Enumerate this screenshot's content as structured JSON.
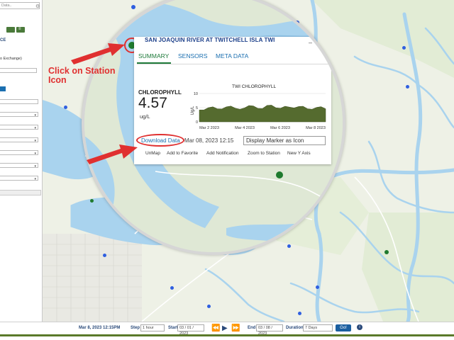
{
  "sidebar": {
    "search_placeholder": "Data..",
    "item_exchange": "o Exchange)",
    "section_label": "CE"
  },
  "popup": {
    "station_title": "SAN JOAQUIN RIVER AT TWITCHELL ISLA TWI",
    "minimize_icon": "minus",
    "close_icon": "close",
    "tabs": [
      "SUMMARY",
      "SENSORS",
      "META DATA"
    ],
    "measurement_label": "CHLOROPHYLL",
    "measurement_value": "4.57",
    "measurement_unit": "ug/L",
    "download_label": "Download Data",
    "timestamp": "Mar 08, 2023 12:15",
    "display_select_value": "Display Marker as Icon",
    "actions": [
      "UnMap",
      "Add to Favorite",
      "Add Notification",
      "Zoom to Station",
      "New Y Axis"
    ]
  },
  "chart_data": {
    "type": "area",
    "title": "TWI CHLOROPHYLL",
    "ylabel": "Ug/L",
    "xlabel": "",
    "ylim": [
      0,
      10
    ],
    "yticks": [
      "10",
      "5",
      "0"
    ],
    "xticks": [
      "Mar 2 2023",
      "Mar 4 2023",
      "Mar 6 2023",
      "Mar 8 2023"
    ],
    "x": [
      "Mar 1",
      "Mar 1.5",
      "Mar 2",
      "Mar 2.5",
      "Mar 3",
      "Mar 3.5",
      "Mar 4",
      "Mar 4.5",
      "Mar 5",
      "Mar 5.5",
      "Mar 6",
      "Mar 6.5",
      "Mar 7",
      "Mar 7.5",
      "Mar 8"
    ],
    "values": [
      4.2,
      5.0,
      4.6,
      5.3,
      4.8,
      4.9,
      5.6,
      4.7,
      5.9,
      4.8,
      5.2,
      5.4,
      4.6,
      5.1,
      4.6
    ],
    "color": "#556b2f",
    "grid": true
  },
  "annotations": {
    "click_instruction": "Click on Station Icon"
  },
  "bottombar": {
    "current_time": "Mar 8, 2023 12:15PM",
    "step_label": "Step",
    "step_value": "1 hour",
    "start_label": "Start",
    "start_value": "03 / 01 / 2023",
    "end_label": "End",
    "end_value": "03 / 08 / 2023",
    "duration_label": "Duration",
    "duration_value": "7 Days",
    "go_label": "Go!",
    "info_icon": "info"
  },
  "colors": {
    "water": "#a9d3ee",
    "land": "#eef1e6",
    "station_blue": "#2f5fe0",
    "station_green": "#1f7a2e",
    "accent_green": "#1e7a3a",
    "annotation_red": "#e03030"
  }
}
